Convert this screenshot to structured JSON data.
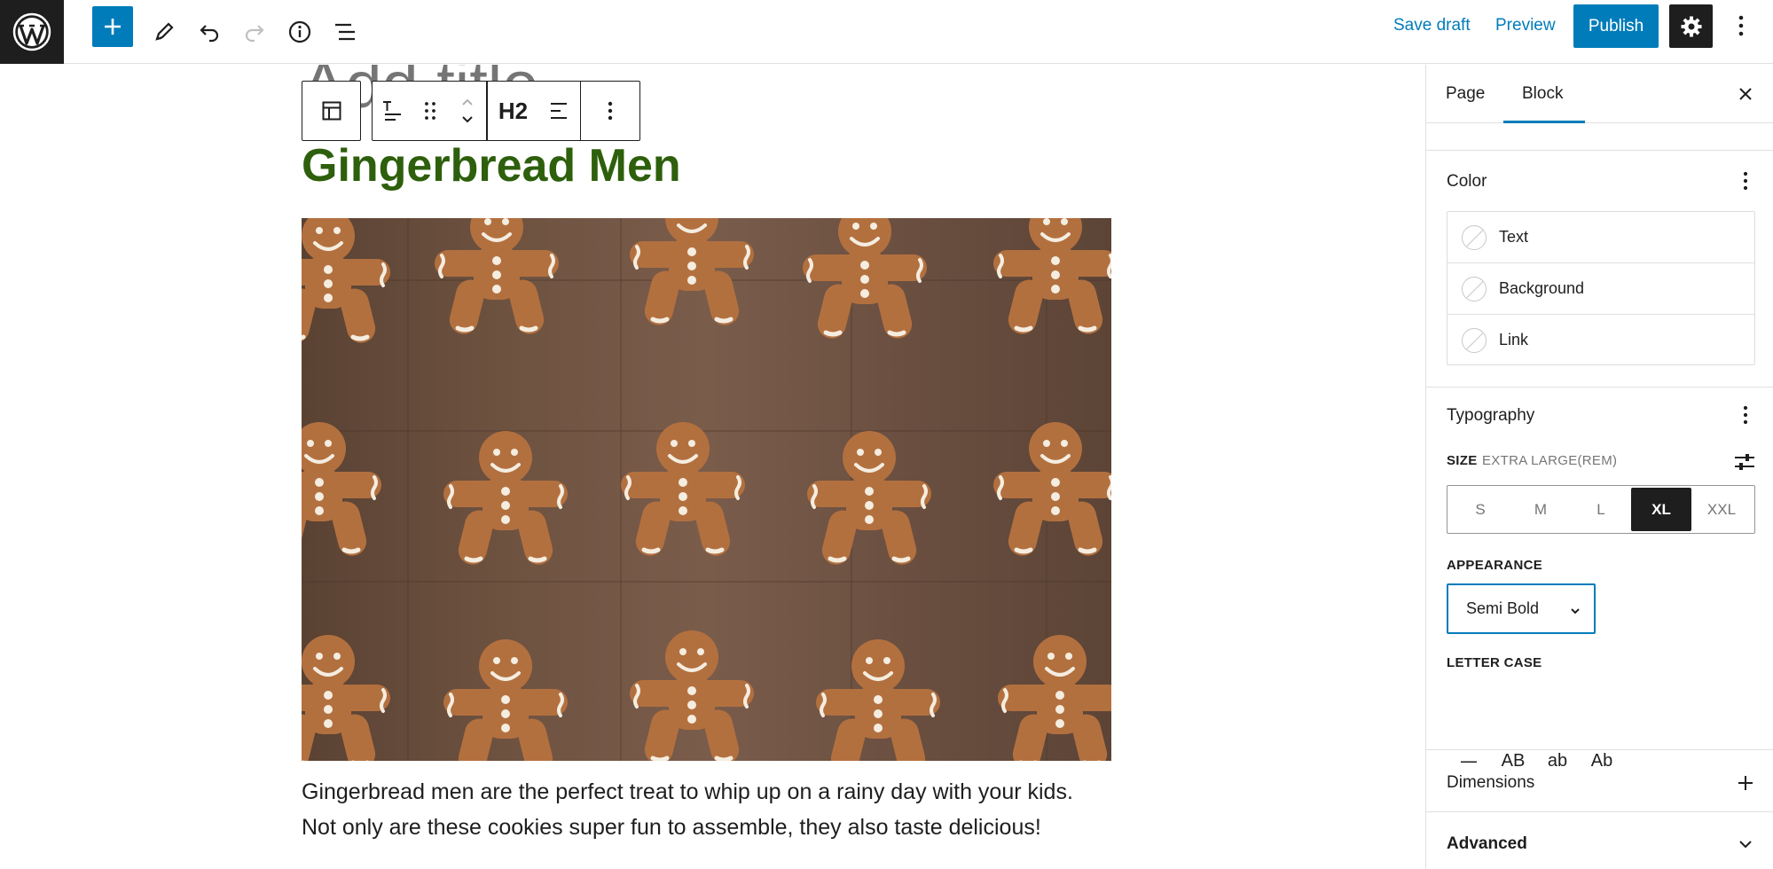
{
  "topbar": {
    "save_draft": "Save draft",
    "preview": "Preview",
    "publish": "Publish"
  },
  "editor": {
    "title_placeholder": "Add title",
    "toolbar": {
      "heading_level": "H2"
    },
    "heading": "Gingerbread Men",
    "paragraph_line1": "Gingerbread men are the perfect treat to whip up on a rainy day with your kids.",
    "paragraph_line2": "Not only are these cookies super fun to assemble, they also taste delicious!"
  },
  "sidebar": {
    "tabs": [
      "Page",
      "Block"
    ],
    "active_tab": "Block",
    "color": {
      "title": "Color",
      "items": [
        "Text",
        "Background",
        "Link"
      ]
    },
    "typography": {
      "title": "Typography",
      "size_label": "SIZE",
      "size_value": "EXTRA LARGE(REM)",
      "size_options": [
        "S",
        "M",
        "L",
        "XL",
        "XXL"
      ],
      "size_selected": "XL",
      "appearance_label": "APPEARANCE",
      "appearance_value": "Semi Bold",
      "letter_case_label": "LETTER CASE",
      "letter_case_options": [
        "—",
        "AB",
        "ab",
        "Ab"
      ]
    },
    "dimensions_title": "Dimensions",
    "advanced_title": "Advanced"
  },
  "colors": {
    "accent": "#007cba",
    "heading": "#2d5f0c",
    "dark": "#1e1e1e"
  }
}
